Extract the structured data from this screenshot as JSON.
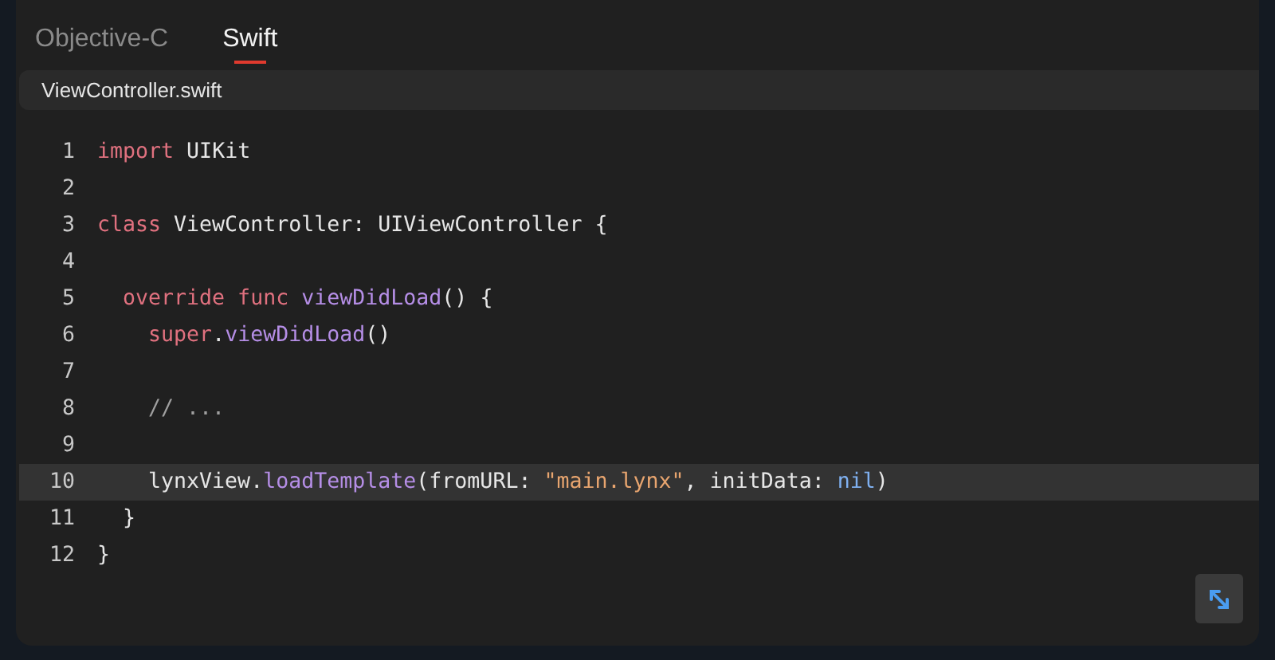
{
  "tabs": [
    {
      "label": "Objective-C",
      "selected": false
    },
    {
      "label": "Swift",
      "selected": true
    }
  ],
  "file": {
    "name": "ViewController.swift"
  },
  "code": {
    "lines": [
      {
        "number": "1",
        "tokens": [
          {
            "text": "import",
            "kind": "keyword"
          },
          {
            "text": " UIKit",
            "kind": "plain"
          }
        ]
      },
      {
        "number": "2"
      },
      {
        "number": "3",
        "tokens": [
          {
            "text": "class",
            "kind": "keyword"
          },
          {
            "text": " ViewController: UIViewController {",
            "kind": "plain"
          }
        ]
      },
      {
        "number": "4"
      },
      {
        "number": "5",
        "tokens": [
          {
            "text": "  override func",
            "kind": "keyword"
          },
          {
            "text": " viewDidLoad",
            "kind": "function"
          },
          {
            "text": "() {",
            "kind": "plain"
          }
        ]
      },
      {
        "number": "6",
        "tokens": [
          {
            "text": "    super",
            "kind": "keyword"
          },
          {
            "text": ".",
            "kind": "plain"
          },
          {
            "text": "viewDidLoad",
            "kind": "function"
          },
          {
            "text": "()",
            "kind": "plain"
          }
        ]
      },
      {
        "number": "7"
      },
      {
        "number": "8",
        "tokens": [
          {
            "text": "    // ...",
            "kind": "comment"
          }
        ]
      },
      {
        "number": "9"
      },
      {
        "number": "10",
        "highlighted": true,
        "tokens": [
          {
            "text": "    lynxView.",
            "kind": "plain"
          },
          {
            "text": "loadTemplate",
            "kind": "function"
          },
          {
            "text": "(fromURL: ",
            "kind": "plain"
          },
          {
            "text": "\"main.lynx\"",
            "kind": "string"
          },
          {
            "text": ", initData: ",
            "kind": "plain"
          },
          {
            "text": "nil",
            "kind": "literal"
          },
          {
            "text": ")",
            "kind": "plain"
          }
        ]
      },
      {
        "number": "11",
        "tokens": [
          {
            "text": "  }",
            "kind": "plain"
          }
        ]
      },
      {
        "number": "12",
        "tokens": [
          {
            "text": "}",
            "kind": "plain"
          }
        ]
      }
    ]
  }
}
